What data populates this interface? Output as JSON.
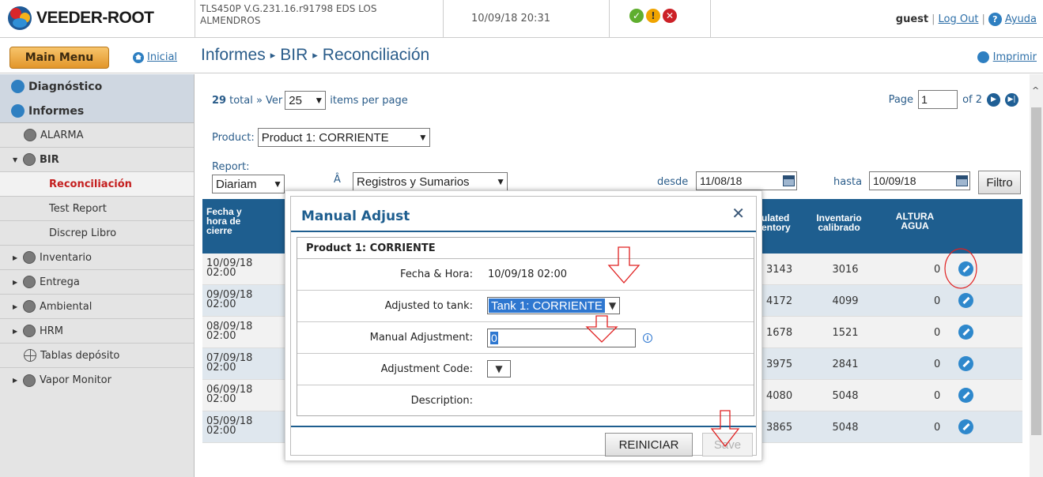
{
  "header": {
    "logo_text": "VEEDER-ROOT",
    "device_name": "TLS450P V.G.231.16.r91798 EDS LOS ALMENDROS",
    "datetime": "10/09/18 20:31",
    "status_icons": [
      "ok-icon",
      "warning-icon",
      "error-icon"
    ],
    "user": "guest",
    "logout": "Log Out",
    "help": "Ayuda"
  },
  "menubar": {
    "main_menu": "Main Menu",
    "home": "Inicial",
    "breadcrumb": [
      "Informes",
      "BIR",
      "Reconciliación"
    ],
    "print": "Imprimir"
  },
  "sidebar": {
    "groups": [
      "Diagnóstico",
      "Informes"
    ],
    "items": [
      {
        "label": "ALARMA",
        "icon": "alarm-icon"
      },
      {
        "label": "BIR",
        "icon": "bir-icon",
        "expanded": true
      },
      {
        "label": "Inventario",
        "icon": "inventory-icon"
      },
      {
        "label": "Entrega",
        "icon": "delivery-icon"
      },
      {
        "label": "Ambiental",
        "icon": "environmental-icon"
      },
      {
        "label": "HRM",
        "icon": "hrm-icon"
      },
      {
        "label": "Tablas depósito",
        "icon": "tank-tables-icon"
      },
      {
        "label": "Vapor Monitor",
        "icon": "vapor-icon"
      }
    ],
    "bir_sub": [
      "Reconciliación",
      "Test Report",
      "Discrep Libro"
    ]
  },
  "controls": {
    "total": "29",
    "total_suffix": "total » Ver",
    "per_page": "25",
    "items_per_page": "items per page",
    "page_label": "Page",
    "page_value": "1",
    "page_of": "of 2",
    "product_label": "Product:",
    "product_value": "Product 1: CORRIENTE",
    "report_label": "Report:",
    "report_value": "Diariam",
    "a_char": "Â",
    "registros_value": "Registros y Sumarios",
    "desde_label": "desde",
    "desde_value": "11/08/18",
    "hasta_label": "hasta",
    "hasta_value": "10/09/18",
    "filtro": "Filtro"
  },
  "table": {
    "headers": {
      "fecha": [
        "Fecha y",
        "hora de",
        "cierre"
      ],
      "calc": [
        "ulated",
        "entory"
      ],
      "inv": [
        "Inventario",
        "calibrado"
      ],
      "agua": [
        "ALTURA",
        "AGUA"
      ]
    },
    "rows": [
      {
        "date": "10/09/18",
        "time": "02:00",
        "calc": "3143",
        "inv": "3016",
        "agua": "0"
      },
      {
        "date": "09/09/18",
        "time": "02:00",
        "calc": "4172",
        "inv": "4099",
        "agua": "0"
      },
      {
        "date": "08/09/18",
        "time": "02:00",
        "calc": "1678",
        "inv": "1521",
        "agua": "0"
      },
      {
        "date": "07/09/18",
        "time": "02:00",
        "calc": "3975",
        "inv": "2841",
        "agua": "0"
      },
      {
        "date": "06/09/18",
        "time": "02:00",
        "calc": "4080",
        "inv": "5048",
        "agua": "0"
      },
      {
        "date": "05/09/18",
        "time": "02:00",
        "calc": "3865",
        "inv": "5048",
        "agua": "0"
      }
    ]
  },
  "modal": {
    "title": "Manual Adjust",
    "product": "Product 1: CORRIENTE",
    "fecha_label": "Fecha & Hora:",
    "fecha_value": "10/09/18 02:00",
    "tank_label": "Adjusted to tank:",
    "tank_value": "Tank 1: CORRIENTE",
    "adjust_label": "Manual Adjustment:",
    "adjust_value": "0",
    "code_label": "Adjustment Code:",
    "desc_label": "Description:",
    "reiniciar": "REINICIAR",
    "save": "Save"
  },
  "colors": {
    "accent": "#1e5e8f",
    "annotation": "#e02020"
  }
}
